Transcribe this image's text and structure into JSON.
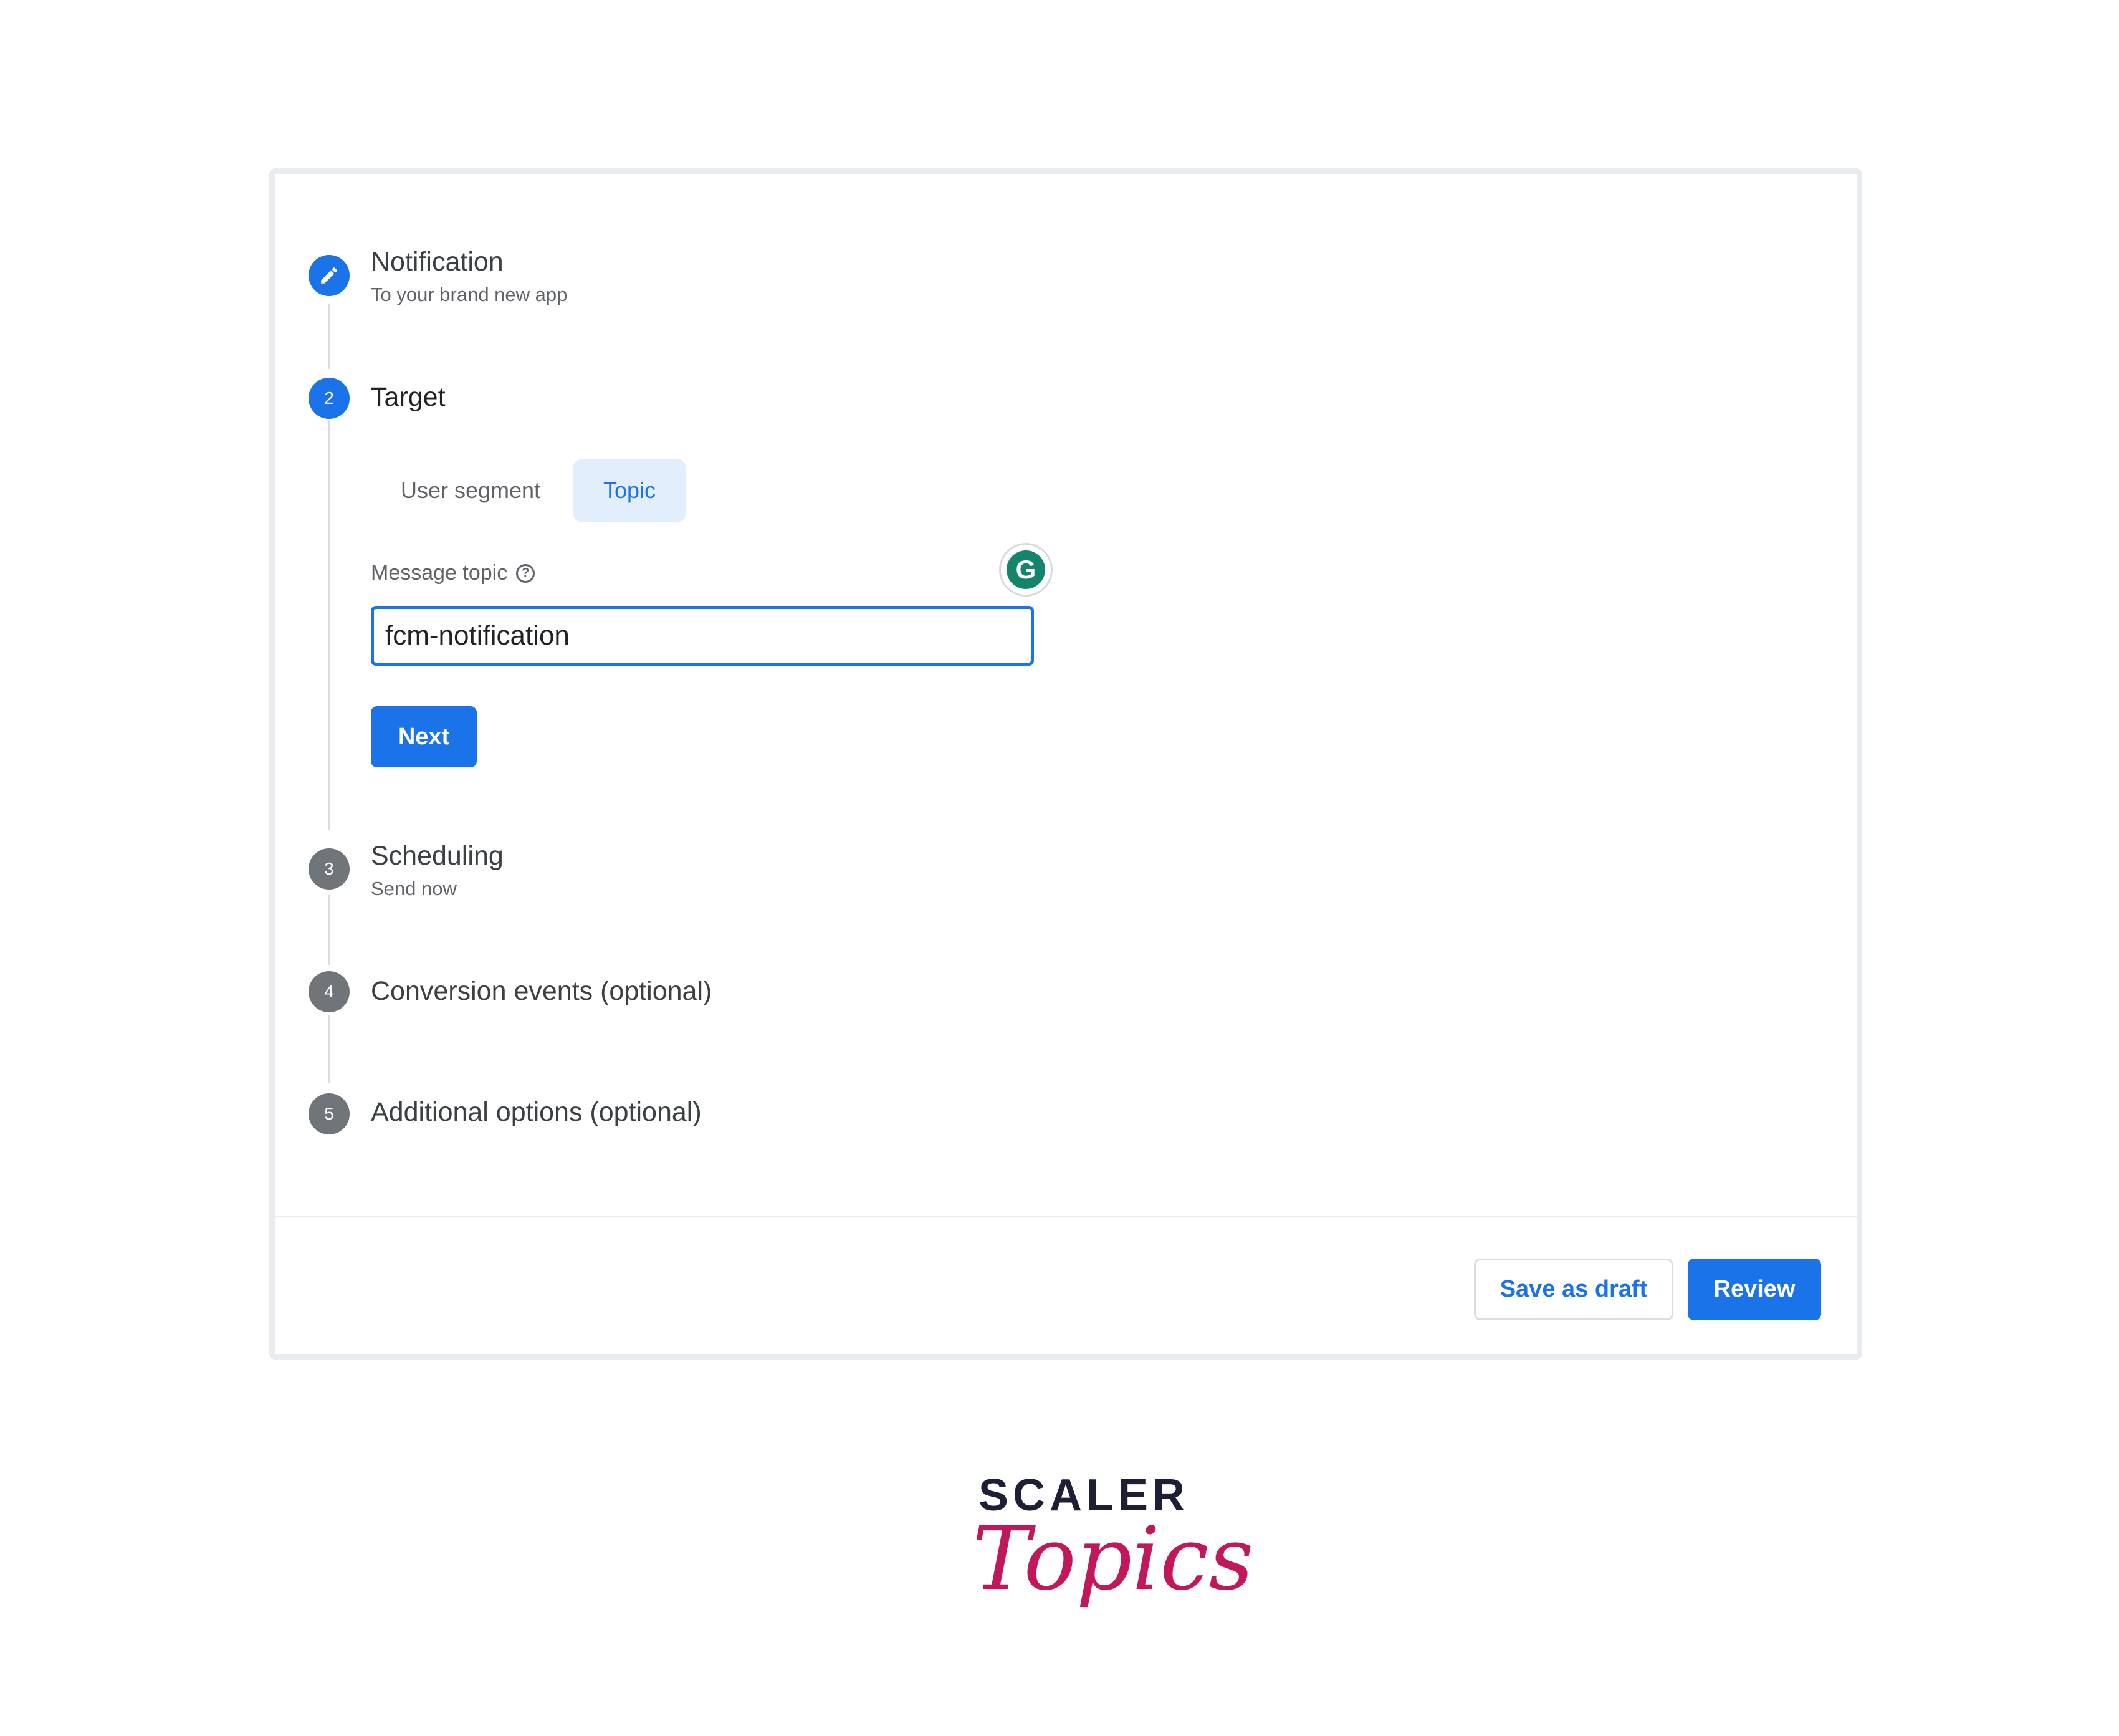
{
  "steps": [
    {
      "number": "",
      "title": "Notification",
      "subtitle": "To your brand new app",
      "state": "edit",
      "icon": "pencil-icon"
    },
    {
      "number": "2",
      "title": "Target",
      "subtitle": "",
      "state": "active"
    },
    {
      "number": "3",
      "title": "Scheduling",
      "subtitle": "Send now",
      "state": "pending"
    },
    {
      "number": "4",
      "title": "Conversion events (optional)",
      "subtitle": "",
      "state": "pending"
    },
    {
      "number": "5",
      "title": "Additional options (optional)",
      "subtitle": "",
      "state": "pending"
    }
  ],
  "target": {
    "tabs": [
      "User segment",
      "Topic"
    ],
    "selected_tab": "Topic",
    "field_label": "Message topic",
    "help_icon": "help-circle-icon",
    "input_value": "fcm-notification",
    "next_label": "Next"
  },
  "extension_icon": "grammarly-icon",
  "footer": {
    "save_draft_label": "Save as draft",
    "review_label": "Review"
  },
  "branding": {
    "line1": "SCALER",
    "line2": "Topics"
  },
  "colors": {
    "accent": "#1a73e8",
    "pending_step": "#70757a",
    "brand_pink": "#c2185b",
    "brand_dark": "#1c1f35"
  }
}
